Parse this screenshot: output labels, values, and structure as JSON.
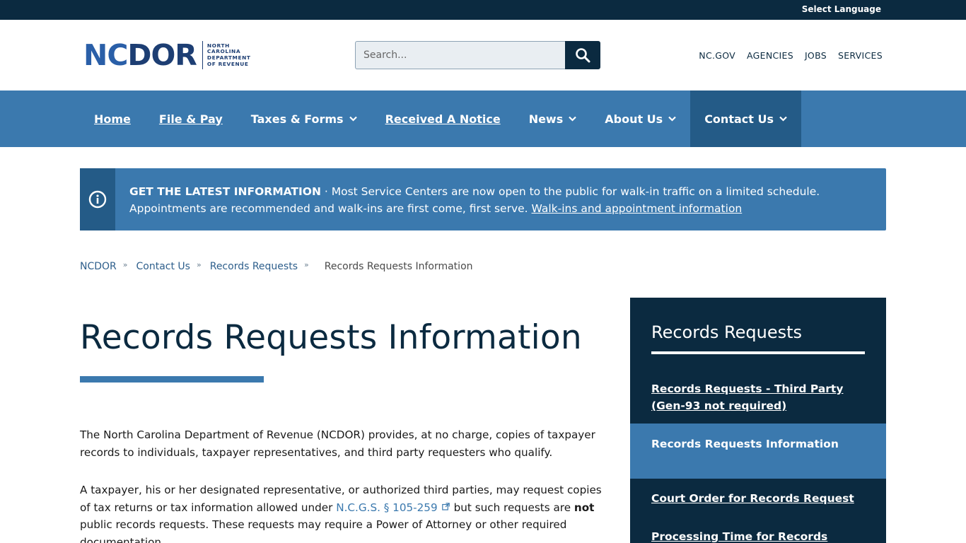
{
  "topbar": {
    "language_label": "Select Language"
  },
  "header": {
    "logo": {
      "mark_nc": "NC",
      "mark_dor": "DOR",
      "subtitle_lines": [
        "NORTH",
        "CAROLINA",
        "DEPARTMENT",
        "OF REVENUE"
      ]
    },
    "search": {
      "placeholder": "Search..."
    },
    "util_links": [
      "NC.GOV",
      "AGENCIES",
      "JOBS",
      "SERVICES"
    ]
  },
  "nav": {
    "items": [
      {
        "label": "Home",
        "dropdown": false
      },
      {
        "label": "File & Pay",
        "dropdown": false
      },
      {
        "label": "Taxes & Forms",
        "dropdown": true
      },
      {
        "label": "Received A Notice",
        "dropdown": false
      },
      {
        "label": "News",
        "dropdown": true
      },
      {
        "label": "About Us",
        "dropdown": true
      },
      {
        "label": "Contact Us",
        "dropdown": true
      }
    ]
  },
  "alert": {
    "heading": "GET THE LATEST INFORMATION",
    "separator": "·",
    "message": "Most Service Centers are now open to the public for walk-in traffic on a limited schedule. Appointments are recommended and walk-ins are first come, first serve.",
    "link_text": "Walk-ins and appointment information",
    "icon": "info-icon"
  },
  "breadcrumb": {
    "items": [
      "NCDOR",
      "Contact Us",
      "Records Requests"
    ],
    "separator": "»",
    "current": "Records Requests Information"
  },
  "main": {
    "title": "Records Requests Information",
    "p1": "The North Carolina Department of Revenue (NCDOR) provides, at no charge, copies of taxpayer records to individuals, taxpayer representatives, and third party requesters who qualify.",
    "p2_before": "A taxpayer, his or her designated representative, or authorized third parties, may request copies of tax returns or tax information allowed under",
    "p2_link": "N.C.G.S. § 105-259",
    "p2_middle": "but such requests are",
    "p2_bold": "not",
    "p2_after": "public records requests. These requests may require a Power of Attorney or other required documentation."
  },
  "sidebar": {
    "title": "Records Requests",
    "items": [
      "Records Requests - Third Party (Gen-93 not required)",
      "Records Requests Information",
      "Court Order for Records Request",
      "Processing Time for Records Request"
    ]
  },
  "colors": {
    "dark_navy": "#0b2a40",
    "primary_blue": "#3b79ae",
    "active_blue": "#245b87"
  }
}
